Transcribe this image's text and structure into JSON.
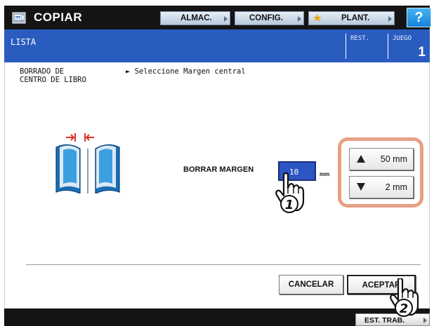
{
  "header": {
    "title": "COPIAR",
    "icon": "copier-icon",
    "buttons": [
      {
        "label": "ALMAC."
      },
      {
        "label": "CONFIG."
      },
      {
        "label": "PLANT.",
        "icon": "star-icon"
      }
    ],
    "help_label": "?"
  },
  "status": {
    "state": "LISTA",
    "rest_label": "REST.",
    "juego_label": "JUEGO",
    "juego_value": "1"
  },
  "main": {
    "function_name_line1": "BORRADO DE",
    "function_name_line2": "CENTRO DE LIBRO",
    "instruction": "► Seleccione Margen central",
    "margin_label": "BORRAR MARGEN",
    "margin_value": "10",
    "margin_unit": "mm",
    "step_up_label": "50 mm",
    "step_down_label": "2 mm"
  },
  "actions": {
    "cancel_label": "CANCELAR",
    "accept_label": "ACEPTAR"
  },
  "bottom": {
    "est_trab_label": "EST. TRAB."
  },
  "callouts": [
    "1",
    "2"
  ],
  "colors": {
    "header_bg": "#141414",
    "status_bg": "#2a5cc0",
    "value_box_bg": "#2d55c3",
    "highlight_border": "#e8a084",
    "help_bg": "#1e90e6",
    "book_blue": "#3aa0e0",
    "arrow_red": "#e0302a"
  }
}
